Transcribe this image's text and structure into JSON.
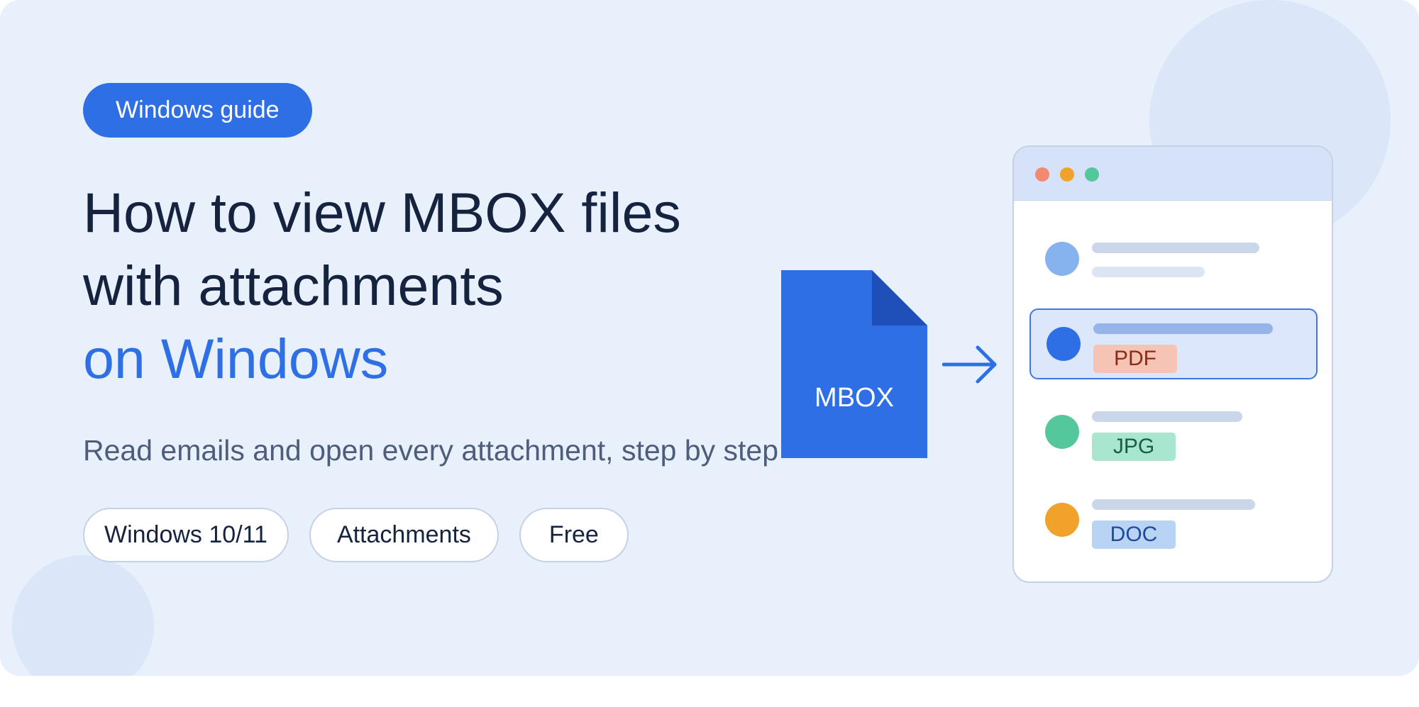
{
  "badge": "Windows guide",
  "title": {
    "line1": "How to view MBOX files",
    "line2": "with attachments",
    "accent": "on Windows"
  },
  "subtitle": "Read emails and open every attachment, step by step",
  "chips": [
    "Windows 10/11",
    "Attachments",
    "Free"
  ],
  "file_label": "MBOX",
  "attachments": [
    {
      "type": "PDF",
      "avatar_color": "#2f6fe6",
      "tag_bg": "#f5c4b4",
      "tag_color": "#8a2c1a"
    },
    {
      "type": "JPG",
      "avatar_color": "#55c79c",
      "tag_bg": "#a9e6cf",
      "tag_color": "#175e43"
    },
    {
      "type": "DOC",
      "avatar_color": "#f0a22a",
      "tag_bg": "#b9d3f5",
      "tag_color": "#1d4b99"
    }
  ],
  "colors": {
    "accent": "#2f6fe6",
    "background": "#e8f0fc",
    "text": "#15233f"
  }
}
